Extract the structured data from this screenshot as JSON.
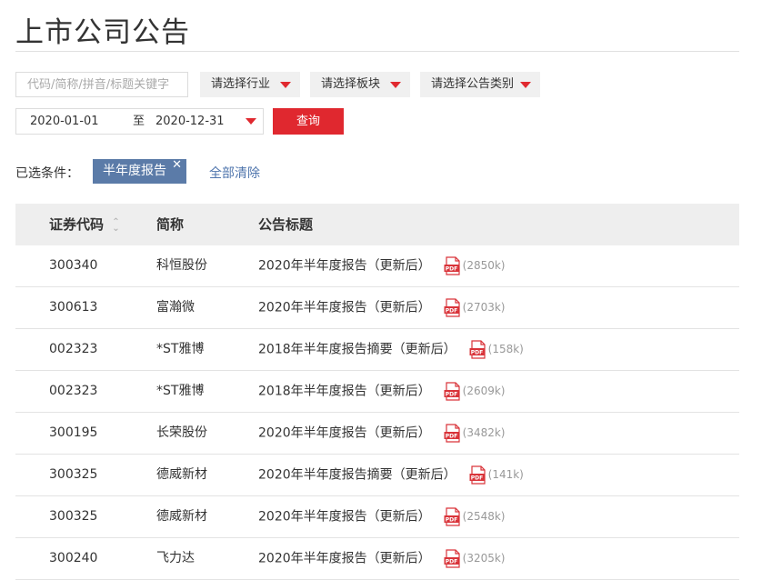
{
  "page": {
    "title": "上市公司公告"
  },
  "filters": {
    "search_placeholder": "代码/简称/拼音/标题关键字",
    "industry_select": "请选择行业",
    "board_select": "请选择板块",
    "category_select": "请选择公告类别",
    "date_start": "2020-01-01",
    "date_separator": "至",
    "date_end": "2020-12-31",
    "query_button": "查询"
  },
  "conditions": {
    "label": "已选条件：",
    "tags": [
      "半年度报告"
    ],
    "clear_all": "全部清除"
  },
  "table": {
    "headers": {
      "code": "证券代码",
      "name": "简称",
      "title": "公告标题"
    },
    "rows": [
      {
        "code": "300340",
        "name": "科恒股份",
        "title": "2020年半年度报告（更新后）",
        "size": "(2850k)"
      },
      {
        "code": "300613",
        "name": "富瀚微",
        "title": "2020年半年度报告（更新后）",
        "size": "(2703k)"
      },
      {
        "code": "002323",
        "name": "*ST雅博",
        "title": "2018年半年度报告摘要（更新后）",
        "size": "(158k)"
      },
      {
        "code": "002323",
        "name": "*ST雅博",
        "title": "2018年半年度报告（更新后）",
        "size": "(2609k)"
      },
      {
        "code": "300195",
        "name": "长荣股份",
        "title": "2020年半年度报告（更新后）",
        "size": "(3482k)"
      },
      {
        "code": "300325",
        "name": "德威新材",
        "title": "2020年半年度报告摘要（更新后）",
        "size": "(141k)"
      },
      {
        "code": "300325",
        "name": "德威新材",
        "title": "2020年半年度报告（更新后）",
        "size": "(2548k)"
      },
      {
        "code": "300240",
        "name": "飞力达",
        "title": "2020年半年度报告（更新后）",
        "size": "(3205k)"
      }
    ]
  },
  "icons": {
    "file": "pdf-icon",
    "remove_tag": "close-icon",
    "dropdown": "caret-down-icon",
    "sort": "sort-icon"
  },
  "colors": {
    "accent": "#e0282f",
    "tag_bg": "#5b7ba8",
    "link": "#4f75ad",
    "header_bg": "#eeeeee"
  }
}
